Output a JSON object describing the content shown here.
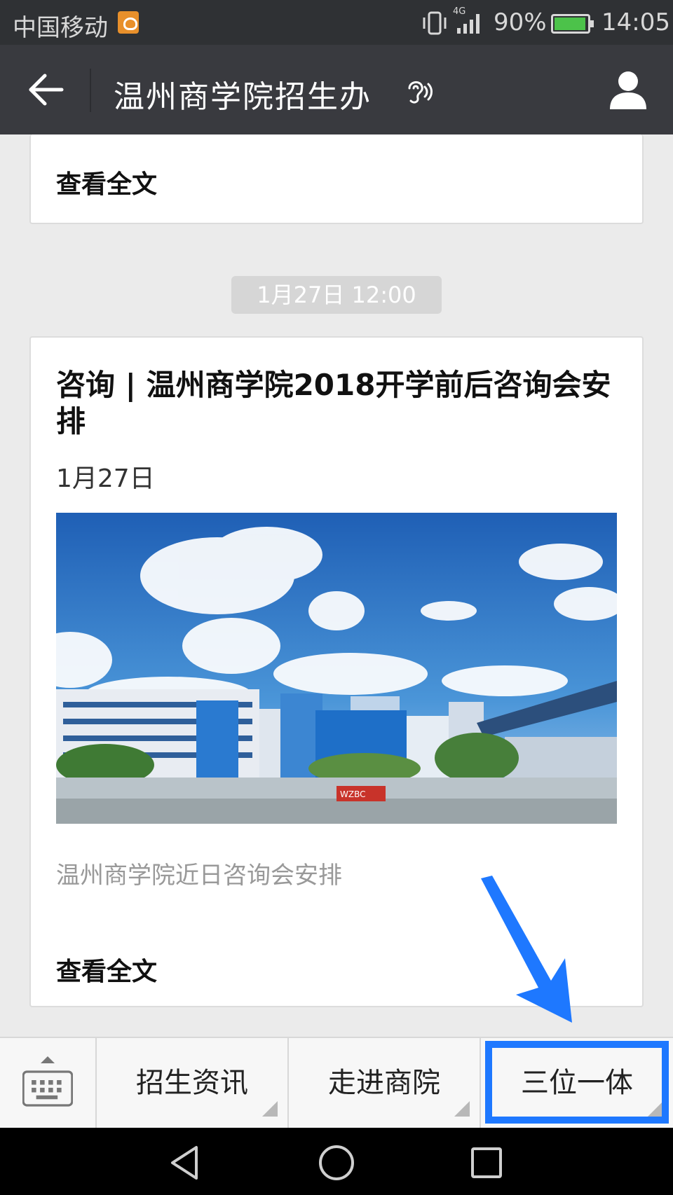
{
  "status_bar": {
    "carrier": "中国移动",
    "network": "4G",
    "battery": "90%",
    "time": "14:05"
  },
  "nav": {
    "title": "温州商学院招生办"
  },
  "feed": {
    "prev_card": {
      "read_full": "查看全文"
    },
    "timestamp": "1月27日  12:00",
    "article": {
      "headline": "咨询 | 温州商学院2018开学前后咨询会安排",
      "date": "1月27日",
      "summary": "温州商学院近日咨询会安排",
      "read_full": "查看全文",
      "cover_sign": "WZBC"
    }
  },
  "menu": {
    "items": [
      {
        "label": "招生资讯"
      },
      {
        "label": "走进商院"
      },
      {
        "label": "三位一体"
      }
    ],
    "highlight_color": "#1e78ff"
  }
}
